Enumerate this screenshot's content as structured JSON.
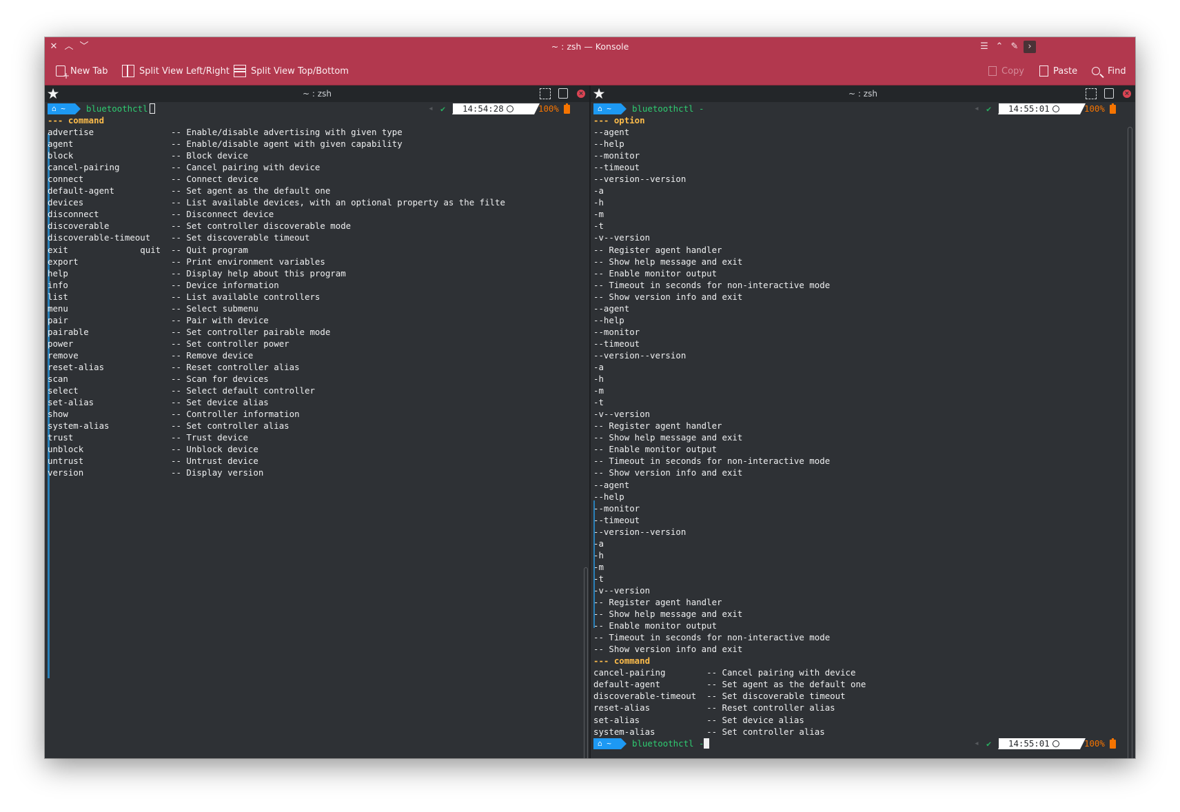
{
  "window": {
    "title": "~ : zsh — Konsole"
  },
  "toolbar": {
    "new_tab": "New Tab",
    "split_lr": "Split View Left/Right",
    "split_tb": "Split View Top/Bottom",
    "copy": "Copy",
    "paste": "Paste",
    "find": "Find"
  },
  "left_pane": {
    "title": "~ : zsh",
    "prompt_home": "~",
    "command": "bluetoothctl",
    "time": "14:54:28",
    "battery": "100%",
    "section": "--- command",
    "rows": [
      {
        "cmd": "advertise",
        "alias": "",
        "desc": "-- Enable/disable advertising with given type"
      },
      {
        "cmd": "agent",
        "alias": "",
        "desc": "-- Enable/disable agent with given capability"
      },
      {
        "cmd": "block",
        "alias": "",
        "desc": "-- Block device"
      },
      {
        "cmd": "cancel-pairing",
        "alias": "",
        "desc": "-- Cancel pairing with device"
      },
      {
        "cmd": "connect",
        "alias": "",
        "desc": "-- Connect device"
      },
      {
        "cmd": "default-agent",
        "alias": "",
        "desc": "-- Set agent as the default one"
      },
      {
        "cmd": "devices",
        "alias": "",
        "desc": "-- List available devices, with an optional property as the filte"
      },
      {
        "cmd": "disconnect",
        "alias": "",
        "desc": "-- Disconnect device"
      },
      {
        "cmd": "discoverable",
        "alias": "",
        "desc": "-- Set controller discoverable mode"
      },
      {
        "cmd": "discoverable-timeout",
        "alias": "",
        "desc": "-- Set discoverable timeout"
      },
      {
        "cmd": "exit",
        "alias": "quit",
        "desc": "-- Quit program"
      },
      {
        "cmd": "export",
        "alias": "",
        "desc": "-- Print environment variables"
      },
      {
        "cmd": "help",
        "alias": "",
        "desc": "-- Display help about this program"
      },
      {
        "cmd": "info",
        "alias": "",
        "desc": "-- Device information"
      },
      {
        "cmd": "list",
        "alias": "",
        "desc": "-- List available controllers"
      },
      {
        "cmd": "menu",
        "alias": "",
        "desc": "-- Select submenu"
      },
      {
        "cmd": "pair",
        "alias": "",
        "desc": "-- Pair with device"
      },
      {
        "cmd": "pairable",
        "alias": "",
        "desc": "-- Set controller pairable mode"
      },
      {
        "cmd": "power",
        "alias": "",
        "desc": "-- Set controller power"
      },
      {
        "cmd": "remove",
        "alias": "",
        "desc": "-- Remove device"
      },
      {
        "cmd": "reset-alias",
        "alias": "",
        "desc": "-- Reset controller alias"
      },
      {
        "cmd": "scan",
        "alias": "",
        "desc": "-- Scan for devices"
      },
      {
        "cmd": "select",
        "alias": "",
        "desc": "-- Select default controller"
      },
      {
        "cmd": "set-alias",
        "alias": "",
        "desc": "-- Set device alias"
      },
      {
        "cmd": "show",
        "alias": "",
        "desc": "-- Controller information"
      },
      {
        "cmd": "system-alias",
        "alias": "",
        "desc": "-- Set controller alias"
      },
      {
        "cmd": "trust",
        "alias": "",
        "desc": "-- Trust device"
      },
      {
        "cmd": "unblock",
        "alias": "",
        "desc": "-- Unblock device"
      },
      {
        "cmd": "untrust",
        "alias": "",
        "desc": "-- Untrust device"
      },
      {
        "cmd": "version",
        "alias": "",
        "desc": "-- Display version"
      }
    ]
  },
  "right_pane": {
    "title": "~ : zsh",
    "prompt_home": "~",
    "command_top": "bluetoothctl -",
    "command_bottom": "bluetoothctl -",
    "time_top": "14:55:01",
    "time_bottom": "14:55:01",
    "battery": "100%",
    "section_option": "--- option",
    "option_lines": [
      "--agent",
      "--help",
      "--monitor",
      "--timeout",
      "--version--version",
      "-a",
      "-h",
      "-m",
      "-t",
      "-v--version",
      "-- Register agent handler",
      "-- Show help message and exit",
      "-- Enable monitor output",
      "-- Timeout in seconds for non-interactive mode",
      "-- Show version info and exit",
      "--agent",
      "--help",
      "--monitor",
      "--timeout",
      "--version--version",
      "-a",
      "-h",
      "-m",
      "-t",
      "-v--version",
      "-- Register agent handler",
      "-- Show help message and exit",
      "-- Enable monitor output",
      "-- Timeout in seconds for non-interactive mode",
      "-- Show version info and exit",
      "--agent",
      "--help",
      "--monitor",
      "--timeout",
      "--version--version",
      "-a",
      "-h",
      "-m",
      "-t",
      "-v--version",
      "-- Register agent handler",
      "-- Show help message and exit",
      "-- Enable monitor output",
      "-- Timeout in seconds for non-interactive mode",
      "-- Show version info and exit"
    ],
    "section_command": "--- command",
    "command_rows": [
      {
        "cmd": "cancel-pairing",
        "desc": "-- Cancel pairing with device"
      },
      {
        "cmd": "default-agent",
        "desc": "-- Set agent as the default one"
      },
      {
        "cmd": "discoverable-timeout",
        "desc": "-- Set discoverable timeout"
      },
      {
        "cmd": "reset-alias",
        "desc": "-- Reset controller alias"
      },
      {
        "cmd": "set-alias",
        "desc": "-- Set device alias"
      },
      {
        "cmd": "system-alias",
        "desc": "-- Set controller alias"
      }
    ]
  },
  "colors": {
    "titlebar": "#b2384e",
    "terminal_bg": "#2e3135",
    "prompt_blue": "#1d99f3",
    "command_green": "#2ecc71",
    "header_yellow": "#fdbc4b",
    "battery_orange": "#f67400"
  }
}
